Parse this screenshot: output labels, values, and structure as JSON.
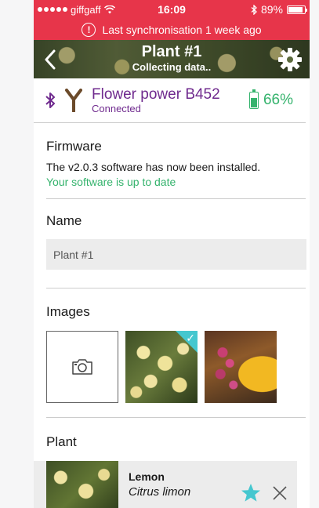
{
  "status_bar": {
    "carrier": "giffgaff",
    "time": "16:09",
    "battery": "89%",
    "battery_level": 0.89
  },
  "sync_banner": {
    "text": "Last synchronisation 1 week ago"
  },
  "header": {
    "title": "Plant #1",
    "subtitle": "Collecting data.."
  },
  "device": {
    "name": "Flower power B452",
    "status": "Connected",
    "battery": "66%",
    "battery_level": 0.66
  },
  "firmware": {
    "title": "Firmware",
    "message": "The v2.0.3 software has now been installed.",
    "status": "Your software is up to date"
  },
  "name_section": {
    "title": "Name",
    "value": "Plant #1"
  },
  "images_section": {
    "title": "Images"
  },
  "plant_section": {
    "title": "Plant",
    "common_name": "Lemon",
    "latin_name": "Citrus limon"
  },
  "colors": {
    "banner_red": "#e7354a",
    "purple": "#6f2a8e",
    "green": "#35b36d",
    "teal": "#45c7cf"
  }
}
